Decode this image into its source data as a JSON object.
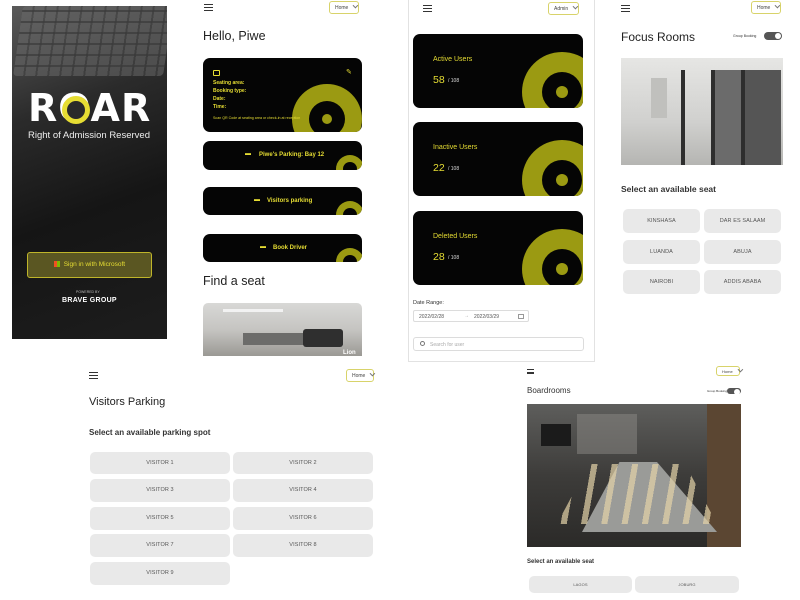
{
  "login": {
    "logo": "ROAR",
    "tagline": "Right of Admission Reserved",
    "signin_label": "Sign in with Microsoft",
    "powered_by": "POWERED BY",
    "brand": "BRAVE GROUP"
  },
  "home": {
    "select_value": "Home",
    "greeting": "Hello, Piwe",
    "booking_card": {
      "seating_area_label": "Seating area:",
      "booking_type_label": "Booking type:",
      "date_label": "Date:",
      "time_label": "Time:",
      "hint": "Scan QR Code at seating area or check-in at reception"
    },
    "buttons": [
      "Piwe's Parking: Bay 12",
      "Visitors parking",
      "Book Driver"
    ],
    "find_seat": "Find a seat",
    "room_caption": "Lion"
  },
  "admin": {
    "select_value": "Admin",
    "stats": [
      {
        "label": "Active Users",
        "value": "58",
        "total": "/ 108"
      },
      {
        "label": "Inactive Users",
        "value": "22",
        "total": "/ 108"
      },
      {
        "label": "Deleted Users",
        "value": "28",
        "total": "/ 108"
      }
    ],
    "date_range_label": "Date Range:",
    "date_from": "2022/02/28",
    "date_to": "2022/03/29",
    "search_placeholder": "Search for user"
  },
  "focus": {
    "select_value": "Home",
    "title": "Focus Rooms",
    "group_booking_label": "Group Booking",
    "subtitle": "Select an available seat",
    "seats": [
      "KINSHASA",
      "DAR ES SALAAM",
      "LUANDA",
      "ABUJA",
      "NAIROBI",
      "ADDIS ABABA"
    ]
  },
  "visitors": {
    "select_value": "Home",
    "title": "Visitors Parking",
    "subtitle": "Select an available parking spot",
    "spots": [
      "VISITOR 1",
      "VISITOR 2",
      "VISITOR 3",
      "VISITOR 4",
      "VISITOR 5",
      "VISITOR 6",
      "VISITOR 7",
      "VISITOR 8",
      "VISITOR 9"
    ]
  },
  "boardrooms": {
    "select_value": "Home",
    "title": "Boardrooms",
    "group_booking_label": "Group Booking",
    "subtitle": "Select an available seat",
    "seats": [
      "LAGOS",
      "JOBURG"
    ]
  },
  "colors": {
    "accent": "#e6dd33",
    "ring": "#9b9a12",
    "card": "#050505"
  }
}
